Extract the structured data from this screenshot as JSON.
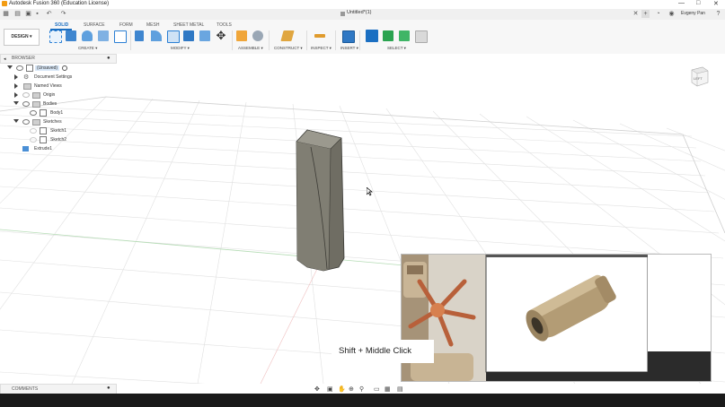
{
  "window": {
    "title": "Autodesk Fusion 360 (Education License)",
    "controls": [
      "—",
      "□",
      "✕"
    ]
  },
  "tabrow": {
    "document_tab": "Untitled*(1)",
    "user": "Evgeny Pan"
  },
  "ribbon": {
    "workspace_button": "DESIGN ▾",
    "tabs": [
      "SOLID",
      "SURFACE",
      "FORM",
      "MESH",
      "SHEET METAL",
      "TOOLS"
    ],
    "active_tab": "SOLID",
    "groups": [
      "CREATE ▾",
      "MODIFY ▾",
      "ASSEMBLE ▾",
      "CONSTRUCT ▾",
      "INSPECT ▾",
      "INSERT ▾",
      "SELECT ▾"
    ]
  },
  "browser": {
    "header": "BROWSER",
    "items": [
      {
        "label": "(Unsaved)"
      },
      {
        "label": "Document Settings"
      },
      {
        "label": "Named Views"
      },
      {
        "label": "Origin"
      },
      {
        "label": "Bodies"
      },
      {
        "label": "Body1"
      },
      {
        "label": "Sketches"
      },
      {
        "label": "Sketch1"
      },
      {
        "label": "Sketch2"
      },
      {
        "label": "Extrude1"
      }
    ]
  },
  "viewcube": {
    "face": "LEFT"
  },
  "comments": {
    "label": "COMMENTS"
  },
  "overlay": {
    "caption": "Shift + Middle Click"
  },
  "colors": {
    "accent": "#1b6fc2",
    "body_fill": "#6e6c62",
    "grid": "#dcdcdc",
    "suppressor": "#b89f78"
  }
}
